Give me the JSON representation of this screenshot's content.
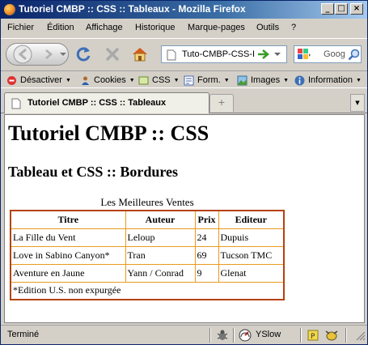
{
  "window": {
    "title": "Tutoriel CMBP :: CSS :: Tableaux - Mozilla Firefox",
    "buttons": {
      "minimize": "_",
      "maximize": "□",
      "close": "×"
    }
  },
  "menu": [
    "Fichier",
    "Édition",
    "Affichage",
    "Historique",
    "Marque-pages",
    "Outils",
    "?"
  ],
  "nav": {
    "url": "Tuto-CMBP-CSS-I",
    "search_placeholder": "Goog"
  },
  "devbar": [
    {
      "label": "Désactiver",
      "icon": "disable-icon"
    },
    {
      "label": "Cookies",
      "icon": "cookies-icon"
    },
    {
      "label": "CSS",
      "icon": "css-icon"
    },
    {
      "label": "Form.",
      "icon": "form-icon"
    },
    {
      "label": "Images",
      "icon": "images-icon"
    },
    {
      "label": "Information",
      "icon": "information-icon"
    }
  ],
  "tab": {
    "label": "Tutoriel CMBP :: CSS :: Tableaux",
    "new_tab": "+"
  },
  "page": {
    "h1": "Tutoriel CMBP :: CSS",
    "h2": "Tableau et CSS :: Bordures",
    "table": {
      "caption": "Les Meilleures Ventes",
      "headers": [
        "Titre",
        "Auteur",
        "Prix",
        "Editeur"
      ],
      "rows": [
        [
          "La Fille du Vent",
          "Leloup",
          "24",
          "Dupuis"
        ],
        [
          "Love in Sabino Canyon*",
          "Tran",
          "69",
          "Tucson TMC"
        ],
        [
          "Aventure en Jaune",
          "Yann / Conrad",
          "9",
          "Glenat"
        ]
      ],
      "footer": "*Edition U.S. non expurgée"
    }
  },
  "status": {
    "text": "Terminé",
    "yslow": "YSlow"
  }
}
